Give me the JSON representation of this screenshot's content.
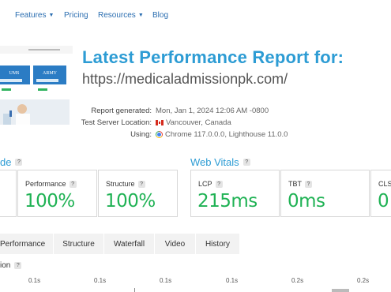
{
  "nav": {
    "features": "Features",
    "pricing": "Pricing",
    "resources": "Resources",
    "blog": "Blog"
  },
  "thumbnail": {
    "left_card": "UMS",
    "right_card": "ARMY"
  },
  "report": {
    "title": "Latest Performance Report for:",
    "url": "https://medicaladmissionpk.com/",
    "generated_label": "Report generated:",
    "generated_value": "Mon, Jan 1, 2024 12:06 AM -0800",
    "location_label": "Test Server Location:",
    "location_value": "Vancouver, Canada",
    "using_label": "Using:",
    "using_value": "Chrome 117.0.0.0, Lighthouse 11.0.0"
  },
  "grade": {
    "heading": "de",
    "performance_label": "Performance",
    "performance_value": "100%",
    "structure_label": "Structure",
    "structure_value": "100%"
  },
  "vitals": {
    "heading": "Web Vitals",
    "lcp_label": "LCP",
    "lcp_value": "215ms",
    "tbt_label": "TBT",
    "tbt_value": "0ms",
    "cls_label": "CLS",
    "cls_value": "0"
  },
  "help_glyph": "?",
  "tabs": [
    "Performance",
    "Structure",
    "Waterfall",
    "Video",
    "History"
  ],
  "waterfall": {
    "heading": "ion",
    "ticks": [
      "0.1s",
      "0.1s",
      "0.1s",
      "0.1s",
      "0.2s",
      "0.2s"
    ]
  },
  "colors": {
    "accent": "#2d9cd4",
    "link": "#2a6db0",
    "good": "#1fb254"
  },
  "icons": {
    "chevron": "chevron-down-icon",
    "help": "help-icon",
    "flag": "canada-flag-icon",
    "browser": "chrome-icon"
  }
}
